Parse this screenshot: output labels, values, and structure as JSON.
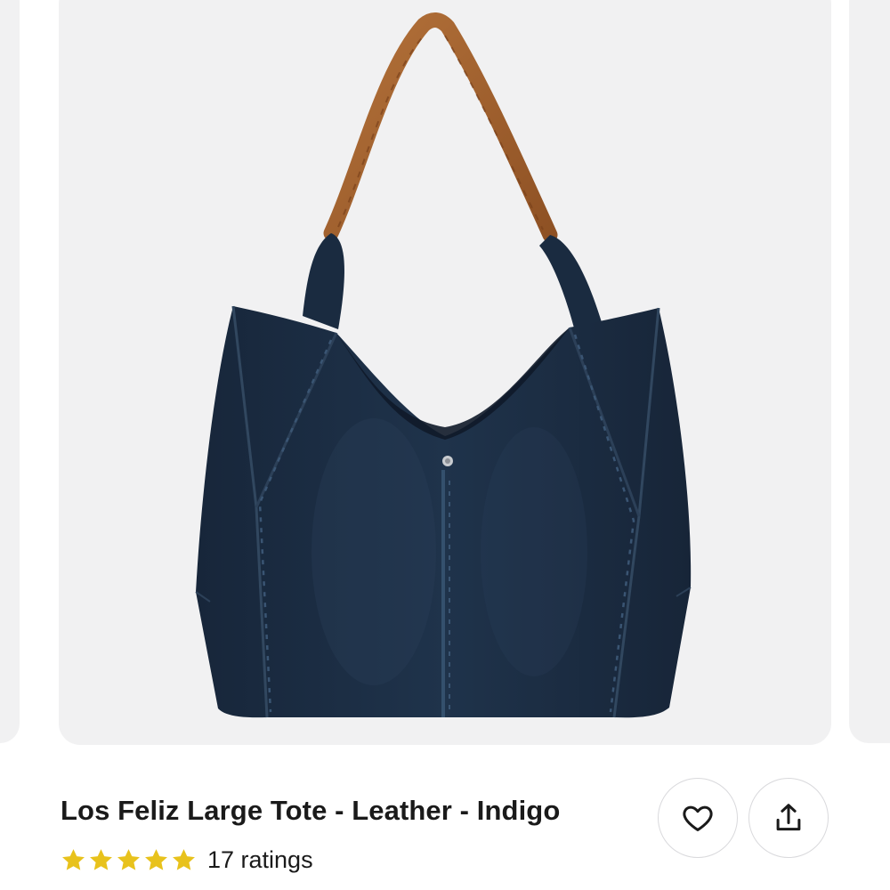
{
  "product": {
    "title": "Los Feliz Large Tote - Leather - Indigo",
    "rating_value": 5,
    "rating_max": 5,
    "ratings_label": "17 ratings"
  },
  "actions": {
    "favorite_icon": "heart-icon",
    "share_icon": "share-icon"
  },
  "colors": {
    "star": "#e8c21c",
    "image_bg": "#f1f1f2",
    "bag": "#1d2f45",
    "strap": "#a8642c",
    "text": "#1a1a1a"
  }
}
